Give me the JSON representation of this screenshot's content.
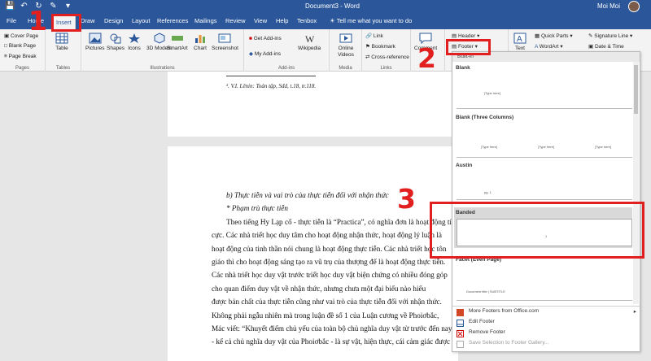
{
  "titlebar": {
    "document_title": "Document3  -  Word",
    "user_name": "Moi Moi"
  },
  "tabs": {
    "items": [
      "File",
      "Home",
      "Insert",
      "Draw",
      "Design",
      "Layout",
      "References",
      "Mailings",
      "Review",
      "View",
      "Help",
      "Tenbox"
    ],
    "active": "Insert",
    "tell_me": "Tell me what you want to do"
  },
  "ribbon": {
    "pages": {
      "cover_page": "Cover Page",
      "blank_page": "Blank Page",
      "page_break": "Page Break",
      "label": "Pages"
    },
    "tables": {
      "table": "Table",
      "label": "Tables"
    },
    "illustrations": {
      "pictures": "Pictures",
      "shapes": "Shapes",
      "icons": "Icons",
      "models": "3D Models",
      "smartart": "SmartArt",
      "chart": "Chart",
      "screenshot": "Screenshot",
      "label": "Illustrations"
    },
    "addins": {
      "get_addins": "Get Add-ins",
      "my_addins": "My Add-ins",
      "wikipedia": "Wikipedia",
      "label": "Add-ins"
    },
    "media": {
      "online_videos": "Online Videos",
      "label": "Media"
    },
    "links": {
      "link": "Link",
      "bookmark": "Bookmark",
      "cross_reference": "Cross-reference",
      "label": "Links"
    },
    "comments": {
      "comment": "Comment"
    },
    "header_footer": {
      "header": "Header",
      "footer": "Footer"
    },
    "text": {
      "text_box": "Text",
      "quick_parts": "Quick Parts",
      "wordart": "WordArt",
      "signature_line": "Signature Line",
      "date_time": "Date & Time"
    }
  },
  "document": {
    "footnote": "². V.I. Lênin: Toàn tập, Sđd, t.18, tr.118.",
    "lines": [
      "b) Thực tiễn và vai trò của thực tiễn đối với nhận thức",
      "* Phạm trù thực tiễn",
      "Theo tiếng Hy Lạp cổ - thực tiễn là “Practica”, có nghĩa đơn là hoạt động tích",
      "cực. Các nhà triết học duy tâm cho hoạt động nhận thức, hoạt động lý luận là",
      "hoạt động của tinh thần nói chung là hoạt động thực tiễn. Các nhà triết học tôn",
      "giáo thì cho hoạt động sáng tạo ra vũ trụ của thượng đế là hoạt động thực tiễn.",
      "Các nhà triết học duy vật trước triết học duy vật biện chứng có nhiều đóng góp",
      "cho quan điểm duy vật về nhận thức, nhưng chưa một đại biểu nào hiểu",
      "được bản chất của thực tiễn cũng như vai trò của thực tiễn đối với nhận thức.",
      "Không phải ngẫu nhiên mà trong luận đề số 1 của Luận cương về Phoiơbắc,",
      "Mác viết: “Khuyết điểm chủ yếu của toàn bộ chủ nghĩa duy vật từ trước đến nay",
      "- kể cả chủ nghĩa duy vật của Phoiơbắc - là sự vật, hiện thực, cái cảm giác được"
    ]
  },
  "footer_gallery": {
    "header": "Built-in",
    "sections": [
      {
        "name": "Blank",
        "thumb_texts": [
          "[Type here]"
        ]
      },
      {
        "name": "Blank (Three Columns)",
        "thumb_texts": [
          "[Type here]",
          "[Type here]",
          "[Type here]"
        ]
      },
      {
        "name": "Austin",
        "thumb_texts": [
          "pg. 1"
        ]
      },
      {
        "name": "Banded",
        "thumb_texts": [
          "1"
        ]
      },
      {
        "name": "Facet (Even Page)",
        "thumb_texts": [
          "Document title | SUBTITLE"
        ]
      }
    ],
    "menu": {
      "more_footers": "More Footers from Office.com",
      "edit_footer": "Edit Footer",
      "remove_footer": "Remove Footer",
      "save_selection": "Save Selection to Footer Gallery..."
    }
  },
  "annotations": {
    "step1": "1",
    "step2": "2",
    "step3": "3"
  },
  "colors": {
    "accent": "#2b579a",
    "annotation": "#e21f1f"
  }
}
